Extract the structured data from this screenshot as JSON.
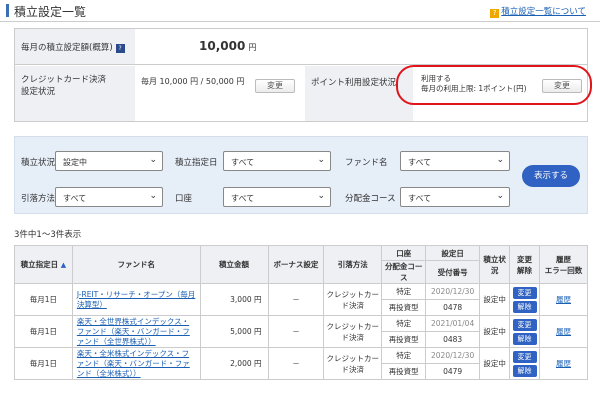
{
  "header": {
    "title": "積立設定一覧",
    "help_icon": "question-icon",
    "help_link": "積立設定一覧について"
  },
  "summary": {
    "monthly_label": "毎月の積立設定額(概算)",
    "monthly_value": "10,000",
    "monthly_unit": "円",
    "cc_label_line1": "クレジットカード決済",
    "cc_label_line2": "設定状況",
    "cc_value": "毎月 10,000 円 / 50,000 円",
    "cc_change": "変更",
    "point_label": "ポイント利用設定状況",
    "point_value_line1": "利用する",
    "point_value_line2": "毎月の利用上限: 1ポイント(円)",
    "point_change": "変更",
    "highlight_color": "#e0151b"
  },
  "filter": {
    "status_label": "積立状況",
    "status_value": "設定中",
    "date_label": "積立指定日",
    "date_value": "すべて",
    "fund_label": "ファンド名",
    "fund_value": "すべて",
    "method_label": "引落方法",
    "method_value": "すべて",
    "account_label": "口座",
    "account_value": "すべて",
    "dist_label": "分配金コース",
    "dist_value": "すべて",
    "show_button": "表示する"
  },
  "list": {
    "count": "3件中1～3件表示",
    "headers": {
      "date": "積立指定日",
      "fund": "ファンド名",
      "amount": "積立金額",
      "bonus": "ボーナス設定",
      "method": "引落方法",
      "account": "口座",
      "dist": "分配金コース",
      "setdate": "設定日",
      "order_no": "受付番号",
      "status": "積立状況",
      "change": "変更",
      "cancel": "解除",
      "history": "履歴",
      "error_count": "エラー回数"
    },
    "rows": [
      {
        "date": "毎月1日",
        "fund": "J-REIT・リサーチ・オープン（毎月決算型）",
        "amount": "3,000 円",
        "bonus": "－",
        "method": "クレジットカード決済",
        "account": "特定",
        "dist": "再投資型",
        "setdate": "2020/12/30",
        "order_no": "0478",
        "status": "設定中",
        "change_btn": "変更",
        "cancel_btn": "解除",
        "history": "履歴"
      },
      {
        "date": "毎月1日",
        "fund": "楽天・全世界株式インデックス・ファンド（楽天・バンガード・ファンド（全世界株式））",
        "amount": "5,000 円",
        "bonus": "－",
        "method": "クレジットカード決済",
        "account": "特定",
        "dist": "再投資型",
        "setdate": "2021/01/04",
        "order_no": "0483",
        "status": "設定中",
        "change_btn": "変更",
        "cancel_btn": "解除",
        "history": "履歴"
      },
      {
        "date": "毎月1日",
        "fund": "楽天・全米株式インデックス・ファンド（楽天・バンガード・ファンド（全米株式））",
        "amount": "2,000 円",
        "bonus": "－",
        "method": "クレジットカード決済",
        "account": "特定",
        "dist": "再投資型",
        "setdate": "2020/12/30",
        "order_no": "0479",
        "status": "設定中",
        "change_btn": "変更",
        "cancel_btn": "解除",
        "history": "履歴"
      }
    ]
  },
  "colors": {
    "accent": "#2f62c2",
    "link": "#1a5fb4",
    "label_bg": "#eef0f4",
    "filter_bg": "#e6eef8"
  }
}
